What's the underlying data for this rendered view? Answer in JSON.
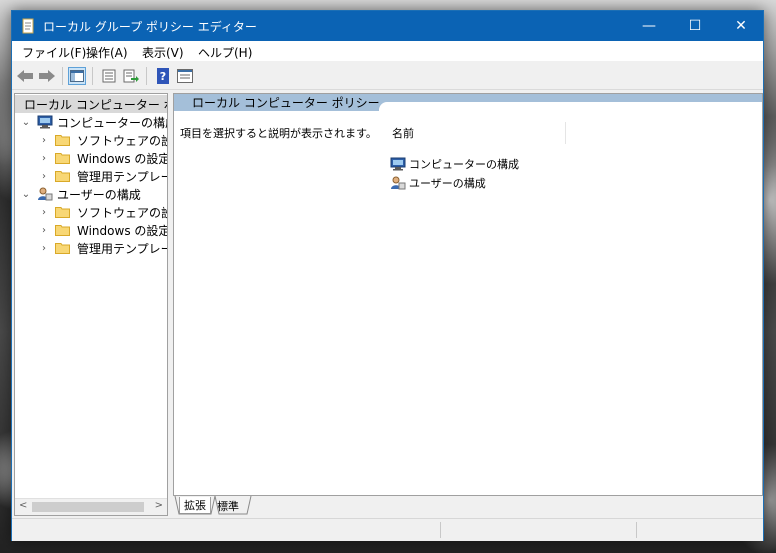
{
  "window": {
    "title": "ローカル グループ ポリシー エディター",
    "controls": {
      "minimize": "—",
      "maximize": "☐",
      "close": "✕"
    }
  },
  "menu": [
    "ファイル(F)",
    "操作(A)",
    "表示(V)",
    "ヘルプ(H)"
  ],
  "toolbar": {
    "icons": [
      "back-arrow-icon",
      "forward-arrow-icon",
      "show-hide-tree-icon",
      "properties-icon",
      "export-list-icon",
      "help-icon",
      "console-view-icon"
    ]
  },
  "tree": {
    "root": "ローカル コンピューター ポリシー",
    "computer": {
      "label": "コンピューターの構成",
      "children": [
        "ソフトウェアの設定",
        "Windows の設定",
        "管理用テンプレート"
      ]
    },
    "user": {
      "label": "ユーザーの構成",
      "children": [
        "ソフトウェアの設定",
        "Windows の設定",
        "管理用テンプレート"
      ]
    },
    "scroll_left": "<",
    "scroll_right": ">"
  },
  "right": {
    "header_title": "ローカル コンピューター ポリシー",
    "description": "項目を選択すると説明が表示されます。",
    "column_name": "名前",
    "items": [
      "コンピューターの構成",
      "ユーザーの構成"
    ]
  },
  "bottom_tabs": [
    "拡張",
    "標準"
  ],
  "colors": {
    "titlebar": "#0b63b4",
    "header_band": "#a4bfd9",
    "selection": "#d9d9d9"
  }
}
